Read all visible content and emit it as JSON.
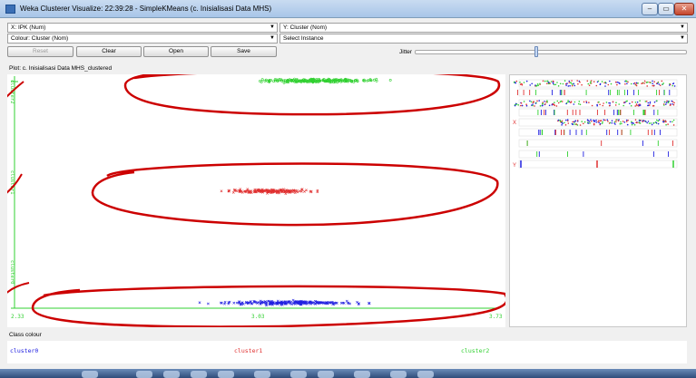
{
  "window": {
    "title": "Weka Clusterer Visualize: 22:39:28 - SimpleKMeans (c. Inisialisasi Data MHS)",
    "minimize_glyph": "–",
    "maximize_glyph": "▭",
    "close_glyph": "✕"
  },
  "controls": {
    "x_axis": "X: IPK (Num)",
    "y_axis": "Y: Cluster (Nom)",
    "colour": "Colour: Cluster (Nom)",
    "instance": "Select Instance",
    "dropdown_arrow": "▼",
    "buttons": {
      "reset": "Reset",
      "clear": "Clear",
      "open": "Open",
      "save": "Save"
    },
    "jitter_label": "Jitter",
    "jitter_level": 0.44
  },
  "plot": {
    "caption": "Plot: c. Inisialisasi Data MHS_clustered",
    "y_labels": [
      "cluster2",
      "cluster1",
      "cluster0"
    ],
    "x_ticks": [
      "2.33",
      "3.03",
      "3.73"
    ],
    "x_range": [
      2.33,
      3.73
    ]
  },
  "colors": {
    "cluster0": "#2020e0",
    "cluster1": "#e03030",
    "cluster2": "#30d030",
    "annotation": "#cc0000"
  },
  "legend": {
    "title": "Class colour",
    "items": [
      "cluster0",
      "cluster1",
      "cluster2"
    ]
  },
  "attr_panel": {
    "markers": [
      "X",
      "Y"
    ]
  }
}
